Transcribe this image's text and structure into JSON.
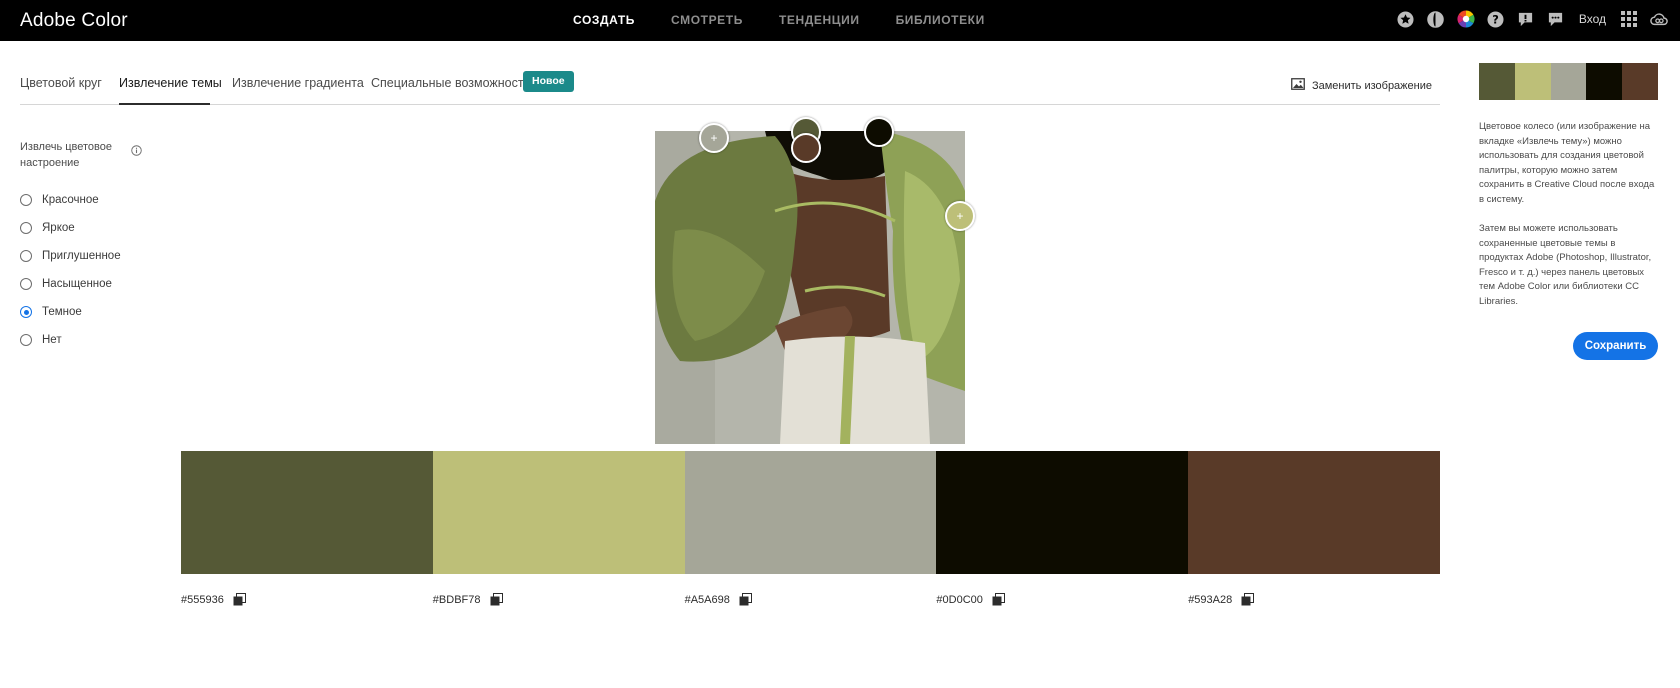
{
  "app": {
    "title": "Adobe Color"
  },
  "nav": {
    "items": [
      {
        "label": "СОЗДАТЬ",
        "active": true
      },
      {
        "label": "СМОТРЕТЬ",
        "active": false
      },
      {
        "label": "ТЕНДЕНЦИИ",
        "active": false
      },
      {
        "label": "БИБЛИОТЕКИ",
        "active": false
      }
    ],
    "login": "Вход",
    "icons": [
      "star-icon",
      "contrast-icon",
      "color-wheel-icon",
      "help-icon",
      "alert-icon",
      "chat-icon",
      "apps-grid-icon",
      "creative-cloud-icon"
    ]
  },
  "tabs": {
    "items": [
      {
        "label": "Цветовой круг",
        "active": false
      },
      {
        "label": "Извлечение темы",
        "active": true
      },
      {
        "label": "Извлечение градиента",
        "active": false
      },
      {
        "label": "Специальные возможности",
        "active": false
      }
    ],
    "badge": "Новое",
    "replace_image": "Заменить изображение"
  },
  "mood": {
    "title": "Извлечь цветовое настроение",
    "options": [
      {
        "label": "Красочное",
        "checked": false
      },
      {
        "label": "Яркое",
        "checked": false
      },
      {
        "label": "Приглушенное",
        "checked": false
      },
      {
        "label": "Насыщенное",
        "checked": false
      },
      {
        "label": "Темное",
        "checked": true
      },
      {
        "label": "Нет",
        "checked": false
      }
    ]
  },
  "palette": {
    "colors": [
      {
        "hex": "#555936",
        "label": "#555936"
      },
      {
        "hex": "#BDBF78",
        "label": "#BDBF78"
      },
      {
        "hex": "#A5A698",
        "label": "#A5A698"
      },
      {
        "hex": "#0D0C00",
        "label": "#0D0C00"
      },
      {
        "hex": "#593A28",
        "label": "#593A28"
      }
    ]
  },
  "panel": {
    "description_1": "Цветовое колесо (или изображение на вкладке «Извлечь тему») можно использовать для создания цветовой палитры, которую можно затем сохранить в Creative Cloud после входа в систему.",
    "description_2": "Затем вы можете использовать сохраненные цветовые темы в продуктах Adobe (Photoshop, Illustrator, Fresco и т. д.) через панель цветовых тем Adobe Color или библиотеки CC Libraries.",
    "save_label": "Сохранить"
  },
  "colors": {
    "accent": "#1473e6",
    "badge": "#1b8a8a",
    "topbar": "#000000"
  }
}
